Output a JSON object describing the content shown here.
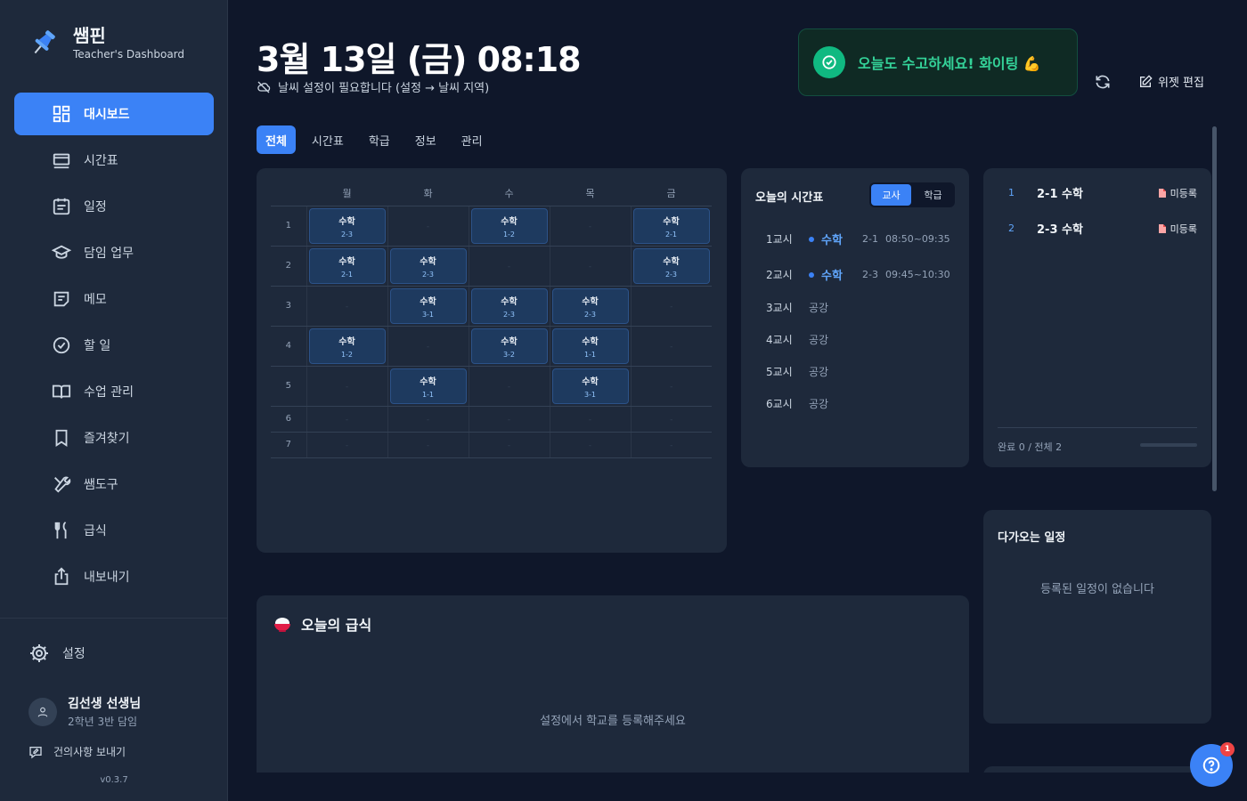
{
  "brand": {
    "title": "쌤핀",
    "subtitle": "Teacher's Dashboard"
  },
  "sidebar": {
    "items": [
      {
        "label": "대시보드",
        "icon": "dashboard-icon",
        "active": true
      },
      {
        "label": "시간표",
        "icon": "timetable-icon"
      },
      {
        "label": "일정",
        "icon": "calendar-icon"
      },
      {
        "label": "담임 업무",
        "icon": "graduation-cap-icon"
      },
      {
        "label": "메모",
        "icon": "memo-icon"
      },
      {
        "label": "할 일",
        "icon": "check-circle-icon"
      },
      {
        "label": "수업 관리",
        "icon": "book-icon"
      },
      {
        "label": "즐겨찾기",
        "icon": "bookmark-icon"
      },
      {
        "label": "쌤도구",
        "icon": "tools-icon"
      },
      {
        "label": "급식",
        "icon": "utensils-icon"
      },
      {
        "label": "내보내기",
        "icon": "export-icon"
      }
    ],
    "settings_label": "설정",
    "user_name": "김선생 선생님",
    "user_role": "2학년 3반 담임",
    "feedback_label": "건의사항 보내기",
    "version": "v0.3.7"
  },
  "header": {
    "datetime": "3월 13일 (금) 08:18",
    "weather_note": "날씨 설정이 필요합니다 (설정 → 날씨 지역)",
    "greeting": "오늘도 수고하세요! 화이팅 💪",
    "edit_widgets": "위젯 편집"
  },
  "tabs": [
    "전체",
    "시간표",
    "학급",
    "정보",
    "관리"
  ],
  "timetable": {
    "days": [
      "월",
      "화",
      "수",
      "목",
      "금"
    ],
    "rows": [
      {
        "period": "1",
        "cells": [
          {
            "s": "수학",
            "r": "2-3"
          },
          null,
          {
            "s": "수학",
            "r": "1-2"
          },
          null,
          {
            "s": "수학",
            "r": "2-1"
          }
        ]
      },
      {
        "period": "2",
        "cells": [
          {
            "s": "수학",
            "r": "2-1"
          },
          {
            "s": "수학",
            "r": "2-3"
          },
          null,
          null,
          {
            "s": "수학",
            "r": "2-3"
          }
        ]
      },
      {
        "period": "3",
        "cells": [
          null,
          {
            "s": "수학",
            "r": "3-1"
          },
          {
            "s": "수학",
            "r": "2-3"
          },
          {
            "s": "수학",
            "r": "2-3"
          },
          null
        ]
      },
      {
        "period": "4",
        "cells": [
          {
            "s": "수학",
            "r": "1-2"
          },
          null,
          {
            "s": "수학",
            "r": "3-2"
          },
          {
            "s": "수학",
            "r": "1-1"
          },
          null
        ]
      },
      {
        "period": "5",
        "cells": [
          null,
          {
            "s": "수학",
            "r": "1-1"
          },
          null,
          {
            "s": "수학",
            "r": "3-1"
          },
          null
        ]
      },
      {
        "period": "6",
        "cells": [
          null,
          null,
          null,
          null,
          null
        ]
      },
      {
        "period": "7",
        "cells": [
          null,
          null,
          null,
          null,
          null
        ]
      }
    ]
  },
  "today": {
    "title": "오늘의 시간표",
    "toggle": [
      "교사",
      "학급"
    ],
    "lessons": [
      {
        "period": "1교시",
        "subject": "수학",
        "room": "2-1",
        "time": "08:50~09:35"
      },
      {
        "period": "2교시",
        "subject": "수학",
        "room": "2-3",
        "time": "09:45~10:30"
      },
      {
        "period": "3교시",
        "free": "공강"
      },
      {
        "period": "4교시",
        "free": "공강"
      },
      {
        "period": "5교시",
        "free": "공강"
      },
      {
        "period": "6교시",
        "free": "공강"
      }
    ]
  },
  "tasks": {
    "items": [
      {
        "num": "1",
        "title": "2-1 수학",
        "status": "미등록"
      },
      {
        "num": "2",
        "title": "2-3 수학",
        "status": "미등록"
      }
    ],
    "footer": "완료 0 / 전체 2",
    "progress": 0
  },
  "events": {
    "title": "다가오는 일정",
    "empty": "등록된 일정이 없습니다"
  },
  "meal": {
    "title": "오늘의 급식",
    "empty": "설정에서 학교를 등록해주세요"
  },
  "help_badge": "1",
  "colors": {
    "accent": "#3b82f6",
    "success": "#10b981",
    "bg": "#0f172a",
    "card": "#1e293b"
  }
}
